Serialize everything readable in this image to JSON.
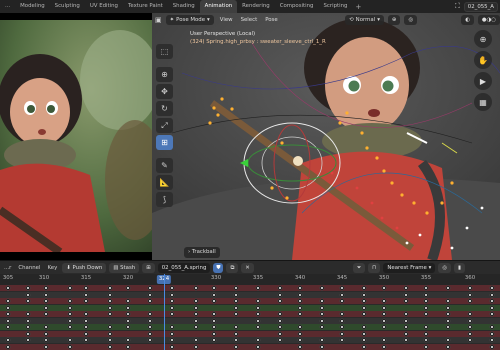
{
  "topbar": {
    "tabs": [
      "...",
      "Modeling",
      "Sculpting",
      "UV Editing",
      "Texture Paint",
      "Shading",
      "Animation",
      "Rendering",
      "Compositing",
      "Scripting",
      "+"
    ],
    "active_tab": "Animation",
    "scene_name": "02_055_A"
  },
  "viewport": {
    "mode": "Pose Mode",
    "menus": [
      "View",
      "Select",
      "Pose"
    ],
    "pivot": "Normal",
    "info_title": "User Perspective (Local)",
    "info_sub": "(324) Spring.high_prbsy : sweater_sleeve_ctrl_1_R",
    "trackball_label": "Trackball"
  },
  "dopesheet": {
    "menus": [
      "...r",
      "Channel",
      "Key"
    ],
    "push_down": "Push Down",
    "stash": "Stash",
    "action_name": "02_055_A.spring",
    "interpolation": "Nearest Frame",
    "current_frame": "324",
    "ticks": [
      "305",
      "310",
      "315",
      "320",
      "325",
      "330",
      "335",
      "340",
      "345",
      "350",
      "355",
      "360"
    ]
  },
  "colors": {
    "accent": "#4772b3",
    "row_red": "#5a2a2e",
    "row_green": "#2f4a2c",
    "row_dark": "#333333"
  }
}
